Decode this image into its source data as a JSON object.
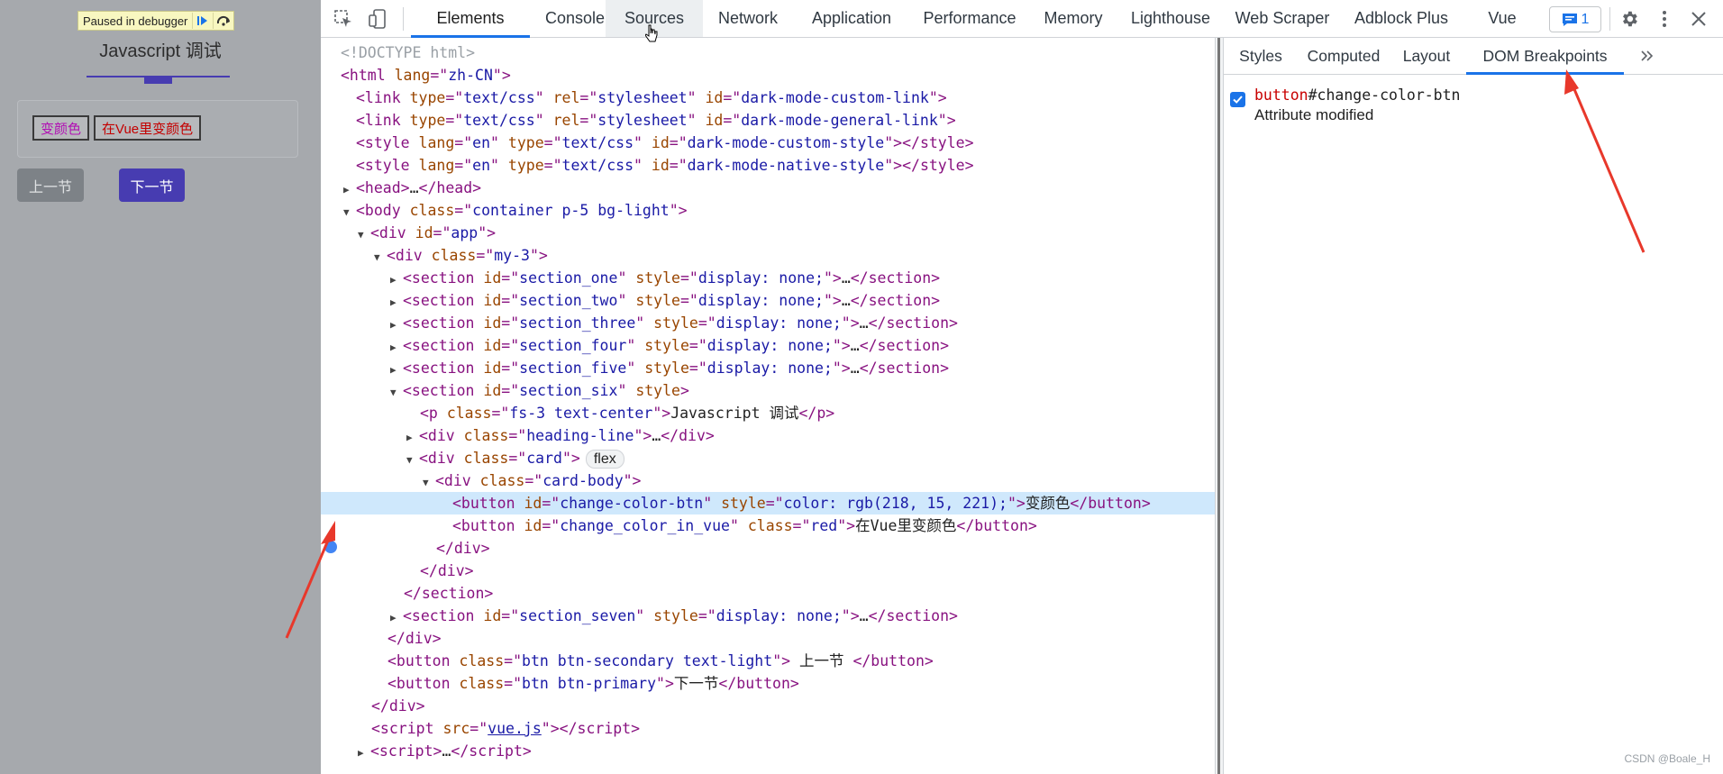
{
  "page": {
    "debugger_badge": "Paused in debugger",
    "title": "Javascript 调试",
    "btn_change_color": "变颜色",
    "btn_change_color_vue": "在Vue里变颜色",
    "btn_prev": "上一节",
    "btn_next": "下一节",
    "colors": {
      "bg": "#a6a9ad",
      "primary": "#473cb1",
      "secondary": "#7c8287",
      "change_color": "#da0fdd",
      "red": "#c40000"
    }
  },
  "devtools": {
    "tabs": [
      "Elements",
      "Console",
      "Sources",
      "Network",
      "Application",
      "Performance",
      "Memory",
      "Lighthouse",
      "Web Scraper",
      "Adblock Plus",
      "Vue"
    ],
    "active_tab": "Elements",
    "hover_tab": "Sources",
    "issues_count": "1",
    "sidebar_tabs": [
      "Styles",
      "Computed",
      "Layout",
      "DOM Breakpoints"
    ],
    "active_sidebar_tab": "DOM Breakpoints",
    "breakpoint": {
      "checked": true,
      "tag": "button",
      "id": "#change-color-btn",
      "type": "Attribute modified"
    },
    "dom": {
      "l01": "<!DOCTYPE html>",
      "l02_attr": "zh-CN",
      "l03_id": "dark-mode-custom-link",
      "l04_id": "dark-mode-general-link",
      "l05_id": "dark-mode-custom-style",
      "l06_id": "dark-mode-native-style",
      "body_class": "container p-5 bg-light",
      "app_id": "app",
      "my3_class": "my-3",
      "sec1": "section_one",
      "sec2": "section_two",
      "sec3": "section_three",
      "sec4": "section_four",
      "sec5": "section_five",
      "sec6": "section_six",
      "sec7": "section_seven",
      "display_none": "display: none;",
      "p_class": "fs-3 text-center",
      "p_text": "Javascript 调试",
      "heading_class": "heading-line",
      "card_class": "card",
      "card_badge": "flex",
      "card_body_class": "card-body",
      "btn1_id": "change-color-btn",
      "btn1_style": "color: rgb(218, 15, 221);",
      "btn1_text": "变颜色",
      "btn2_id": "change_color_in_vue",
      "btn2_class": "red",
      "btn2_text": "在Vue里变颜色",
      "btn3_class": "btn btn-secondary text-light",
      "btn3_text": " 上一节 ",
      "btn4_class": "btn btn-primary",
      "btn4_text": "下一节",
      "script_src": "vue.js"
    }
  },
  "watermark": "CSDN @Boale_H"
}
